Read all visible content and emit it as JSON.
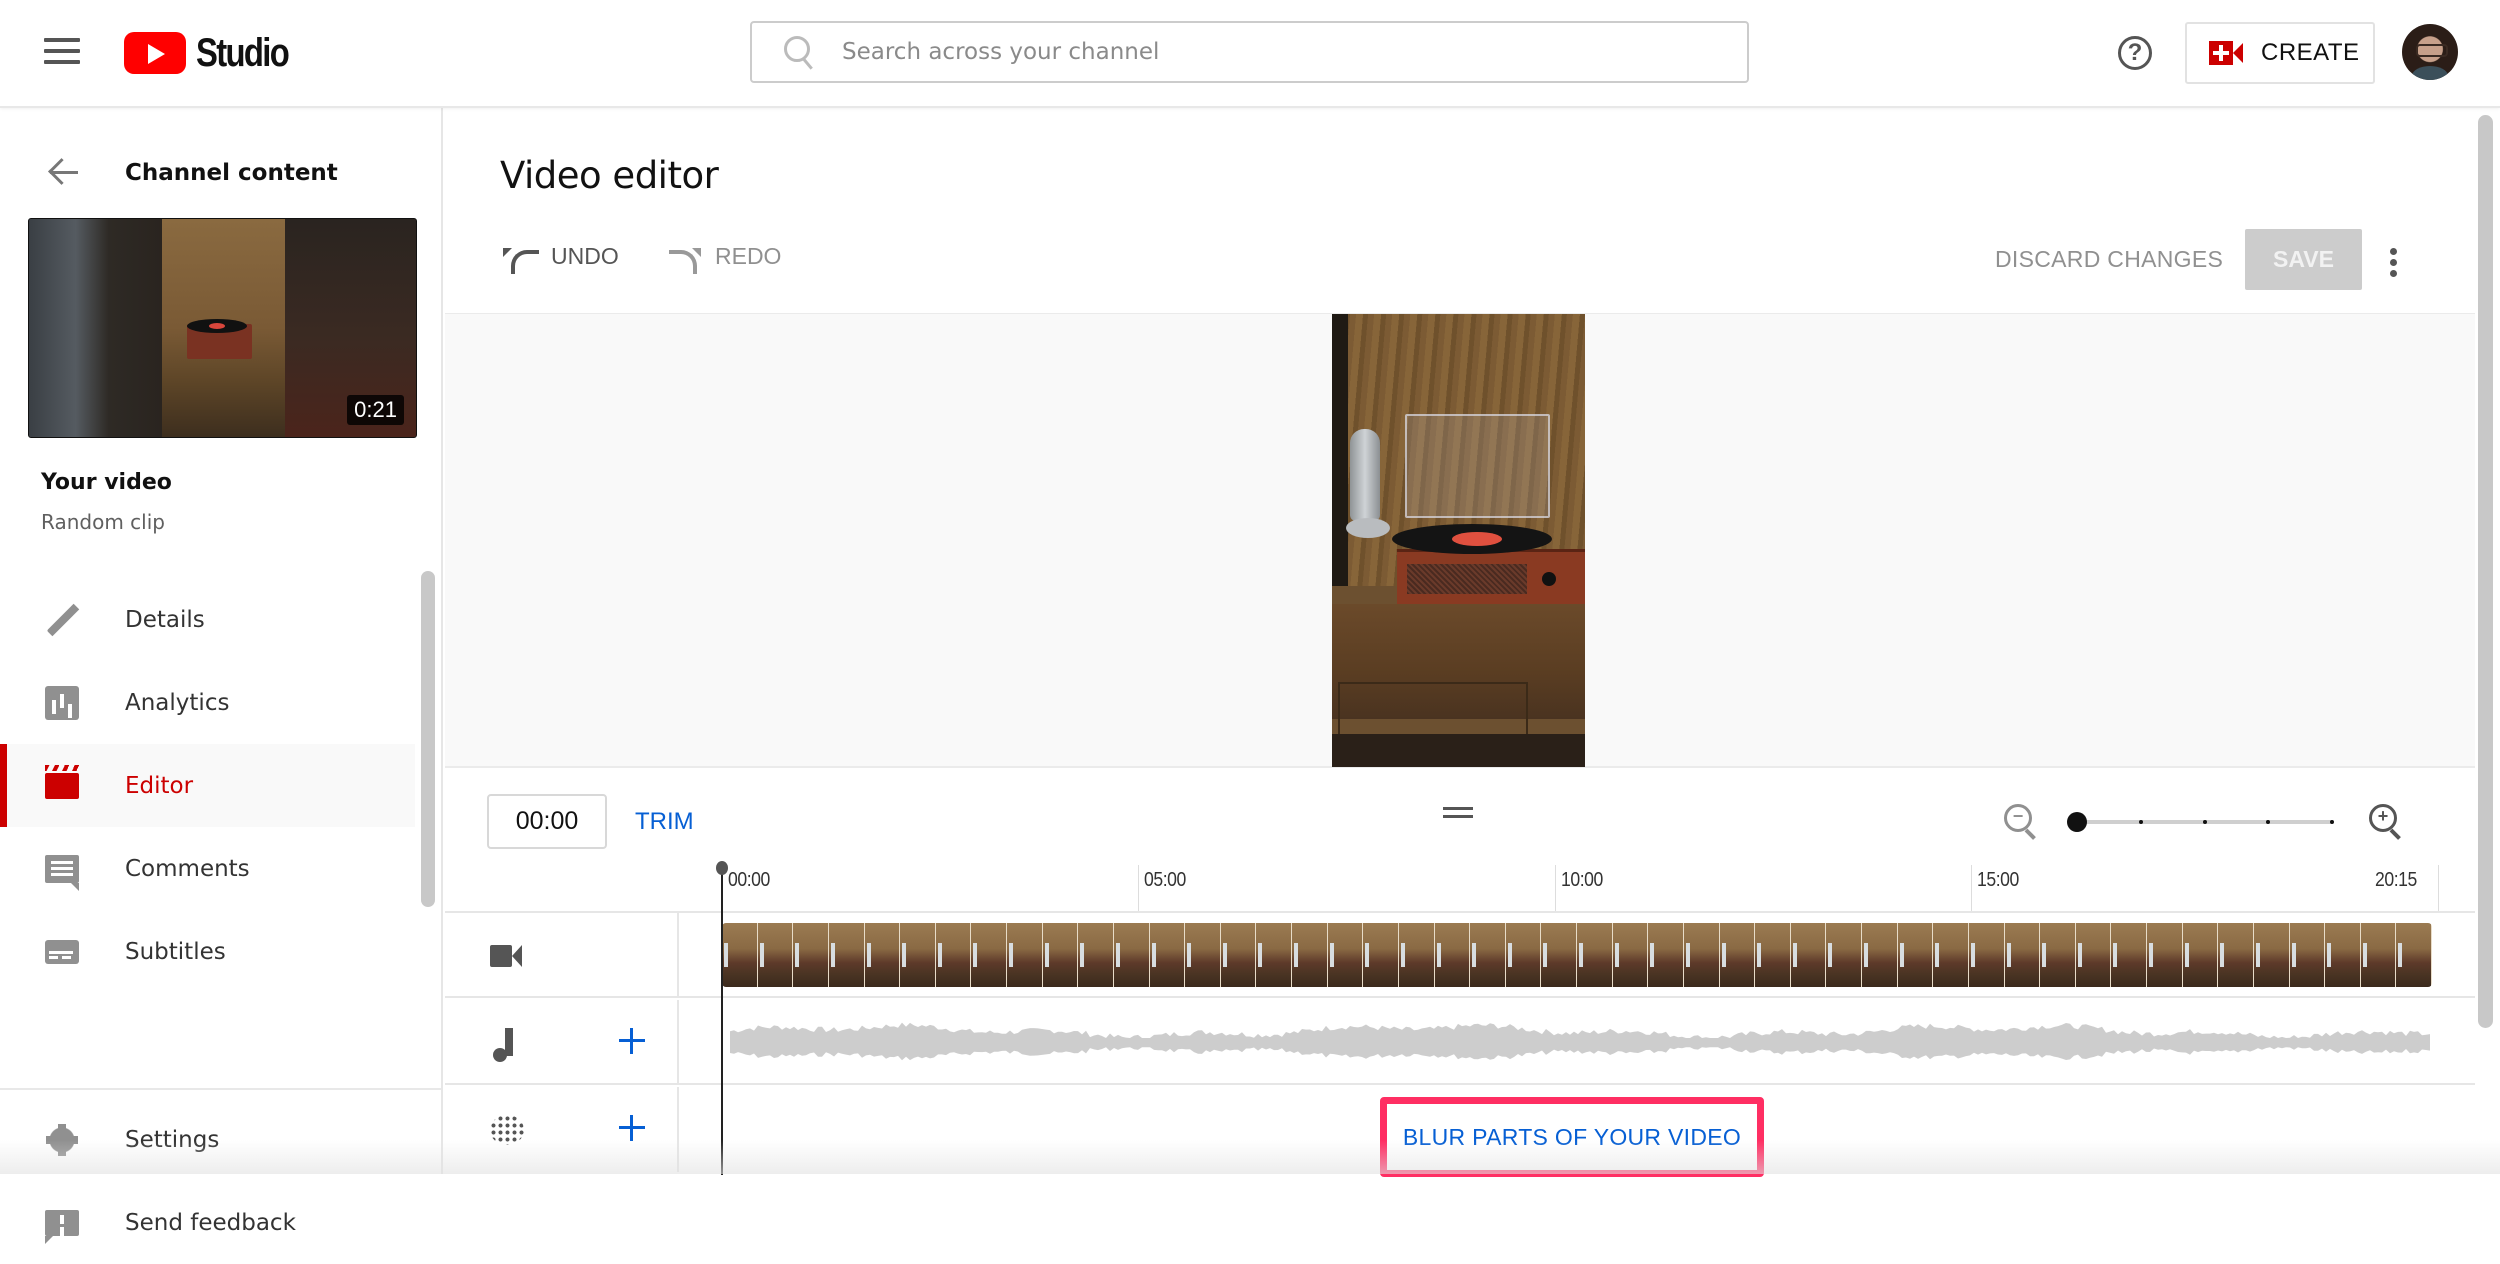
{
  "header": {
    "app_name": "Studio",
    "search_placeholder": "Search across your channel",
    "create_label": "CREATE",
    "icons": {
      "menu": "hamburger-icon",
      "logo": "youtube-play-icon",
      "search": "search-icon",
      "help": "help-circle-icon",
      "create": "video-camera-plus-icon",
      "avatar": "user-avatar"
    },
    "help_glyph": "?"
  },
  "sidebar": {
    "back_label": "Channel content",
    "thumbnail_duration": "0:21",
    "video_title": "Your video",
    "video_subtitle": "Random clip",
    "items": [
      {
        "label": "Details",
        "icon": "pencil-icon",
        "active": false
      },
      {
        "label": "Analytics",
        "icon": "analytics-icon",
        "active": false
      },
      {
        "label": "Editor",
        "icon": "clapperboard-icon",
        "active": true
      },
      {
        "label": "Comments",
        "icon": "comment-icon",
        "active": false
      },
      {
        "label": "Subtitles",
        "icon": "subtitles-icon",
        "active": false
      }
    ],
    "bottom_items": [
      {
        "label": "Settings",
        "icon": "gear-icon"
      },
      {
        "label": "Send feedback",
        "icon": "feedback-icon"
      }
    ],
    "accent_color": "#cc0000"
  },
  "editor": {
    "title": "Video editor",
    "undo_label": "UNDO",
    "redo_label": "REDO",
    "discard_label": "DISCARD CHANGES",
    "save_label": "SAVE",
    "save_enabled": false
  },
  "timeline": {
    "current_time": "00:00",
    "trim_label": "TRIM",
    "zoom_level": 0,
    "zoom_steps": 5,
    "ruler": [
      {
        "label": "00:00",
        "fraction": 0.0
      },
      {
        "label": "05:00",
        "fraction": 0.2437
      },
      {
        "label": "10:00",
        "fraction": 0.4875
      },
      {
        "label": "15:00",
        "fraction": 0.7313
      },
      {
        "label": "20:15",
        "fraction": 1.0
      }
    ],
    "playhead_fraction": 0,
    "tracks": [
      {
        "name": "video",
        "icon": "video-camera-icon",
        "addable": false
      },
      {
        "name": "audio",
        "icon": "music-note-icon",
        "addable": true
      },
      {
        "name": "blur",
        "icon": "blur-icon",
        "addable": true
      }
    ],
    "video_frame_count": 48,
    "blur_button_label": "BLUR PARTS OF YOUR VIDEO",
    "highlight_color": "#ff2e63",
    "link_color": "#065fd4"
  }
}
